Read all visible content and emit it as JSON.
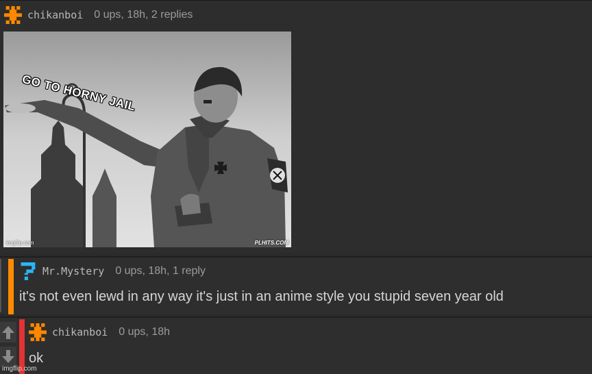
{
  "comments": [
    {
      "username": "chikanboi",
      "stats": "0 ups, 18h, 2 replies",
      "meme": {
        "caption": "GO TO HORNY JAIL",
        "watermark_left": "imgflip.com",
        "watermark_right": "PLHITS.COM"
      }
    },
    {
      "username": "Mr.Mystery",
      "stats": "0 ups, 18h, 1 reply",
      "text": "it's not even lewd in any way it's just in an anime style you stupid seven year old",
      "accent": "#ff8c00"
    },
    {
      "username": "chikanboi",
      "stats": "0 ups, 18h",
      "text": "ok",
      "accent": "#e33333"
    }
  ],
  "footer": {
    "watermark": "imgflip.com"
  },
  "colors": {
    "orange_avatar": "#ff8800",
    "blue_avatar": "#29b6f6"
  }
}
